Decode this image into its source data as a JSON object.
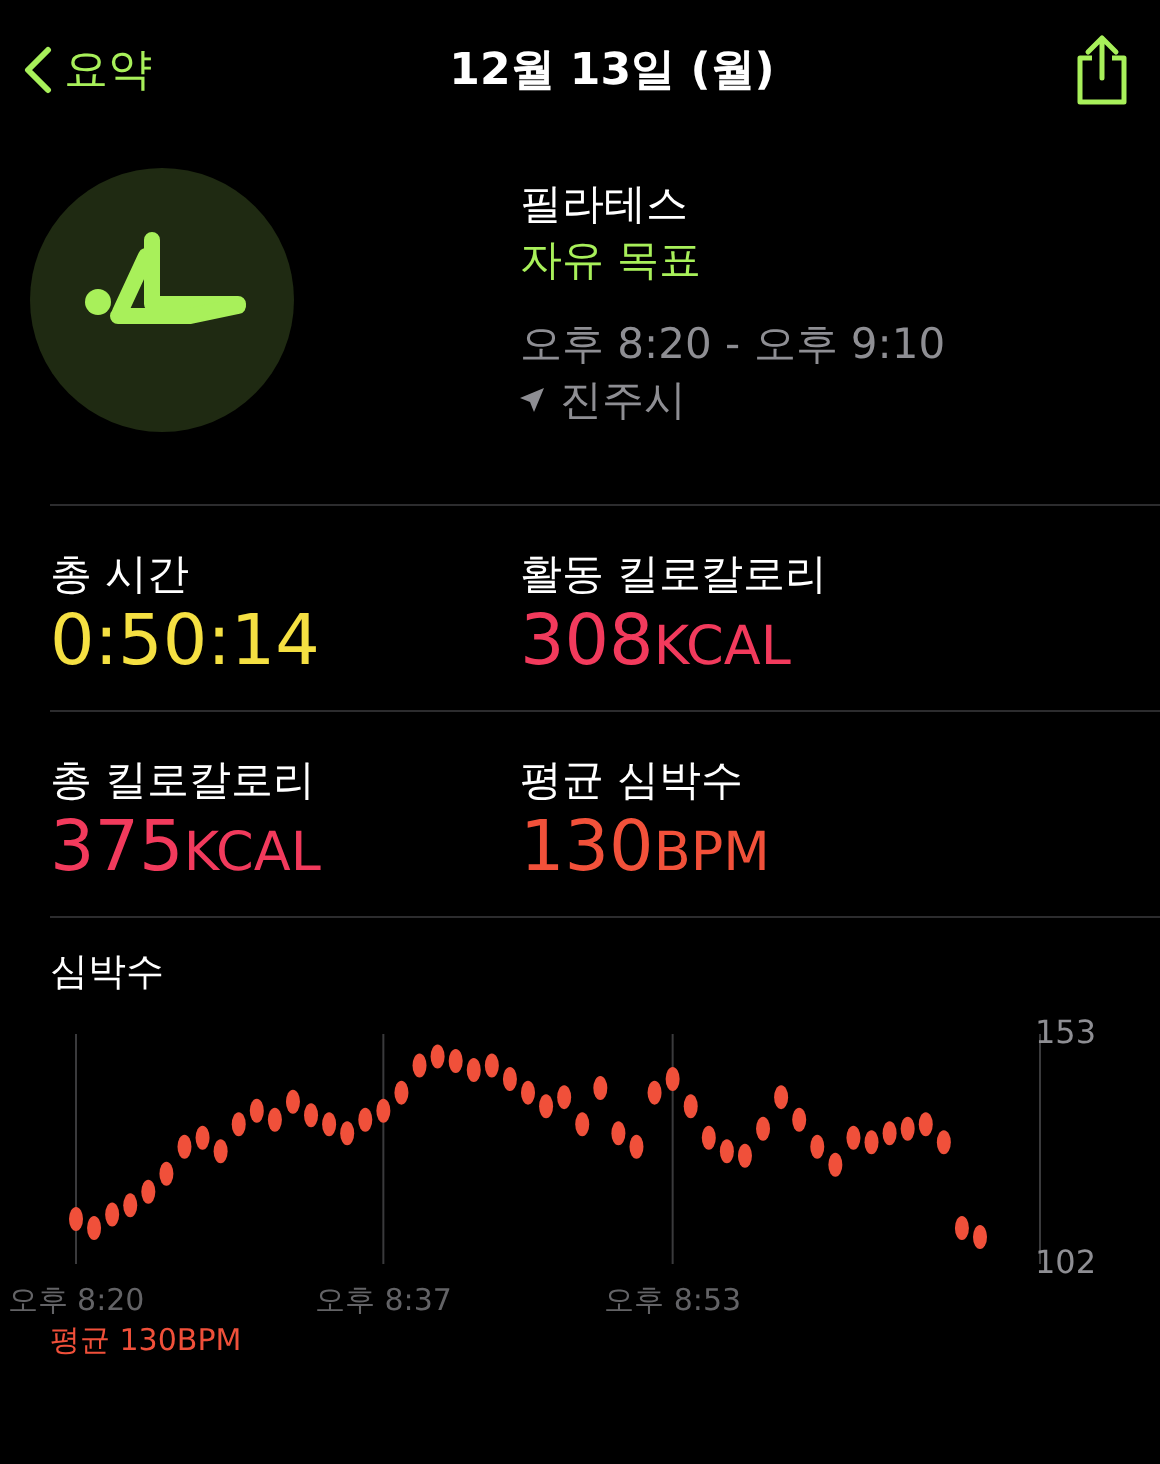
{
  "nav": {
    "back_label": "요약",
    "title": "12월 13일 (월)"
  },
  "workout": {
    "name": "필라테스",
    "goal": "자유 목표",
    "time_range": "오후 8:20 - 오후 9:10",
    "location": "진주시"
  },
  "metrics": [
    {
      "label": "총 시간",
      "value": "0:50:14",
      "color": "#f5e042"
    },
    {
      "label": "활동 킬로칼로리",
      "value": "308",
      "unit": "KCAL",
      "color": "#f23a5c"
    },
    {
      "label": "총 킬로칼로리",
      "value": "375",
      "unit": "KCAL",
      "color": "#f23a5c"
    },
    {
      "label": "평균 심박수",
      "value": "130",
      "unit": "BPM",
      "color": "#f2513a"
    }
  ],
  "heart_rate": {
    "average": "평균 130BPM",
    "chart_data": {
      "type": "scatter",
      "title": "심박수",
      "categories": [
        "오후 8:20",
        null,
        null,
        null,
        null,
        null,
        null,
        null,
        null,
        null,
        null,
        null,
        null,
        null,
        null,
        null,
        null,
        "오후 8:37",
        null,
        null,
        null,
        null,
        null,
        null,
        null,
        null,
        null,
        null,
        null,
        null,
        null,
        null,
        null,
        "오후 8:53",
        null,
        null,
        null,
        null,
        null,
        null,
        null,
        null,
        null,
        null,
        null,
        null,
        null,
        null,
        null,
        null,
        null
      ],
      "series": [
        {
          "color": "#f0503a",
          "values": [
            112,
            110,
            113,
            115,
            118,
            122,
            128,
            130,
            127,
            133,
            136,
            134,
            138,
            135,
            133,
            131,
            134,
            136,
            140,
            146,
            148,
            147,
            145,
            146,
            143,
            140,
            137,
            139,
            133,
            141,
            131,
            128,
            140,
            143,
            137,
            130,
            127,
            126,
            132,
            139,
            134,
            128,
            124,
            130,
            129,
            131,
            132,
            133,
            129,
            110,
            108
          ]
        }
      ],
      "grid": true,
      "ylim": [
        102,
        153
      ],
      "yticks": [
        153,
        102
      ]
    }
  }
}
